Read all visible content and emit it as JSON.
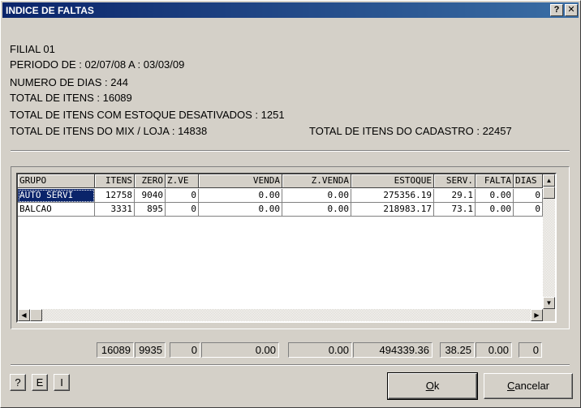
{
  "window": {
    "title": "INDICE DE FALTAS",
    "help_label": "?",
    "close_label": "✕"
  },
  "info": {
    "filial": "FILIAL 01",
    "periodo": "PERIODO DE : 02/07/08 A : 03/03/09",
    "numero_dias": "NUMERO DE DIAS :  244",
    "total_itens": "TOTAL DE ITENS : 16089",
    "total_desativados": "TOTAL DE ITENS COM ESTOQUE DESATIVADOS :  1251",
    "total_mix": "TOTAL DE ITENS DO MIX / LOJA : 14838",
    "total_cadastro": "TOTAL DE ITENS DO CADASTRO : 22457"
  },
  "grid": {
    "columns": [
      "GRUPO",
      "ITENS",
      "ZERO",
      "Z.VE",
      "VENDA",
      "Z.VENDA",
      "ESTOQUE",
      "SERV.",
      "FALTA",
      "DIAS"
    ],
    "rows": [
      [
        "AUTO SERVI",
        "12758",
        "9040",
        "0",
        "0.00",
        "0.00",
        "275356.19",
        "29.1",
        "0.00",
        "0"
      ],
      [
        "BALCAO",
        "3331",
        "895",
        "0",
        "0.00",
        "0.00",
        "218983.17",
        "73.1",
        "0.00",
        "0"
      ]
    ]
  },
  "totals": [
    "16089",
    "9935",
    "0",
    "0.00",
    "0.00",
    "494339.36",
    "38.25",
    "0.00",
    "0"
  ],
  "buttons": {
    "help": "?",
    "e": "E",
    "i": "I",
    "ok_mnemonic": "O",
    "ok_rest": "k",
    "cancel_mnemonic": "C",
    "cancel_rest": "ancelar"
  },
  "icons": {
    "scroll_up": "▲",
    "scroll_down": "▼",
    "scroll_left": "◀",
    "scroll_right": "▶"
  }
}
